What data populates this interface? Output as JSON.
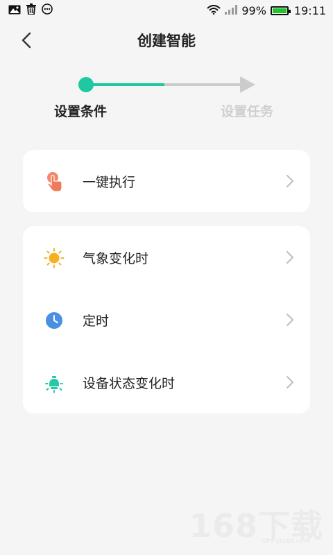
{
  "status_bar": {
    "icons": [
      "image-icon",
      "trash-icon",
      "more-dots-icon"
    ],
    "battery_text": "99%",
    "battery_level": 0.99,
    "time": "19:11",
    "battery_color": "#22c42a"
  },
  "header": {
    "title": "创建智能",
    "back_icon": "chevron-left-icon"
  },
  "stepper": {
    "progress": 0.5,
    "steps": [
      {
        "label": "设置条件",
        "active": true
      },
      {
        "label": "设置任务",
        "active": false
      }
    ],
    "accent_color": "#1ec8a0",
    "inactive_color": "#cccccc"
  },
  "cards": {
    "manual": {
      "items": [
        {
          "label": "一键执行",
          "icon": "tap-finger-icon",
          "icon_color": "#f07b5a"
        }
      ]
    },
    "triggers": {
      "items": [
        {
          "label": "气象变化时",
          "icon": "sun-icon",
          "icon_color": "#f6b022"
        },
        {
          "label": "定时",
          "icon": "clock-icon",
          "icon_color": "#4a90e2"
        },
        {
          "label": "设备状态变化时",
          "icon": "device-bulb-icon",
          "icon_color": "#28c9a5"
        }
      ]
    }
  },
  "watermark": {
    "text": "168下载",
    "sub": "GPS.JIt168.com"
  }
}
